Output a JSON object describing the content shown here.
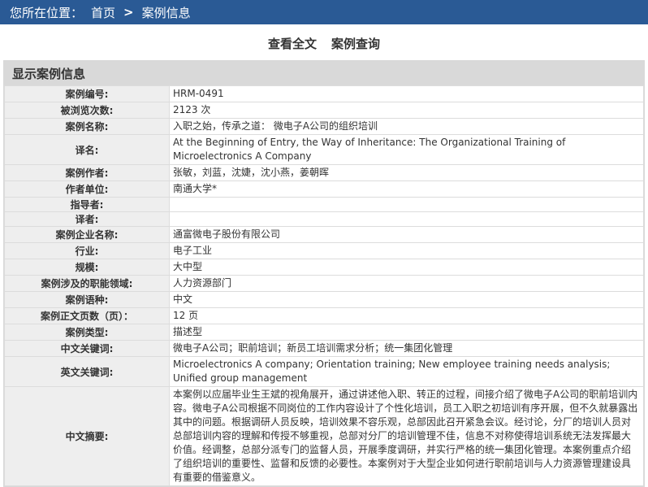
{
  "breadcrumb": {
    "prefix": "您所在位置：",
    "home": "首页",
    "separator": ">",
    "current": "案例信息"
  },
  "actions": {
    "full_text": "查看全文",
    "case_query": "案例查询"
  },
  "section": {
    "title": "显示案例信息"
  },
  "fields": [
    {
      "label": "案例编号:",
      "value": "HRM-0491"
    },
    {
      "label": "被浏览次数:",
      "value": "2123 次"
    },
    {
      "label": "案例名称:",
      "value": "入职之始，传承之道： 微电子A公司的组织培训"
    },
    {
      "label": "译名:",
      "value": "At the Beginning of Entry, the Way of Inheritance: The Organizational Training of Microelectronics A Company"
    },
    {
      "label": "案例作者:",
      "value": "张敏，刘蓝，沈婕，沈小燕，姜朝晖"
    },
    {
      "label": "作者单位:",
      "value": "南通大学*"
    },
    {
      "label": "指导者:",
      "value": ""
    },
    {
      "label": "译者:",
      "value": ""
    },
    {
      "label": "案例企业名称:",
      "value": "通富微电子股份有限公司"
    },
    {
      "label": "行业:",
      "value": "电子工业"
    },
    {
      "label": "规模:",
      "value": "大中型"
    },
    {
      "label": "案例涉及的职能领域:",
      "value": "人力资源部门"
    },
    {
      "label": "案例语种:",
      "value": "中文"
    },
    {
      "label": "案例正文页数（页）：",
      "value": "12 页"
    },
    {
      "label": "案例类型:",
      "value": "描述型"
    },
    {
      "label": "中文关键词:",
      "value": "微电子A公司；职前培训；新员工培训需求分析；统一集团化管理"
    },
    {
      "label": "英文关键词:",
      "value": "Microelectronics A company; Orientation training; New employee training needs analysis; Unified group management"
    },
    {
      "label": "中文摘要:",
      "value": "本案例以应届毕业生王斌的视角展开，通过讲述他入职、转正的过程，间接介绍了微电子A公司的职前培训内容。微电子A公司根据不同岗位的工作内容设计了个性化培训，员工入职之初培训有序开展，但不久就暴露出其中的问题。根据调研人员反映，培训效果不容乐观，总部因此召开紧急会议。经讨论，分厂的培训人员对总部培训内容的理解和传授不够重视，总部对分厂的培训管理不佳，信息不对称使得培训系统无法发挥最大价值。经调整，总部分派专门的监督人员，开展季度调研，并实行严格的统一集团化管理。本案例重点介绍了组织培训的重要性、监督和反馈的必要性。本案例对于大型企业如何进行职前培训与人力资源管理建设具有重要的借鉴意义。"
    }
  ]
}
